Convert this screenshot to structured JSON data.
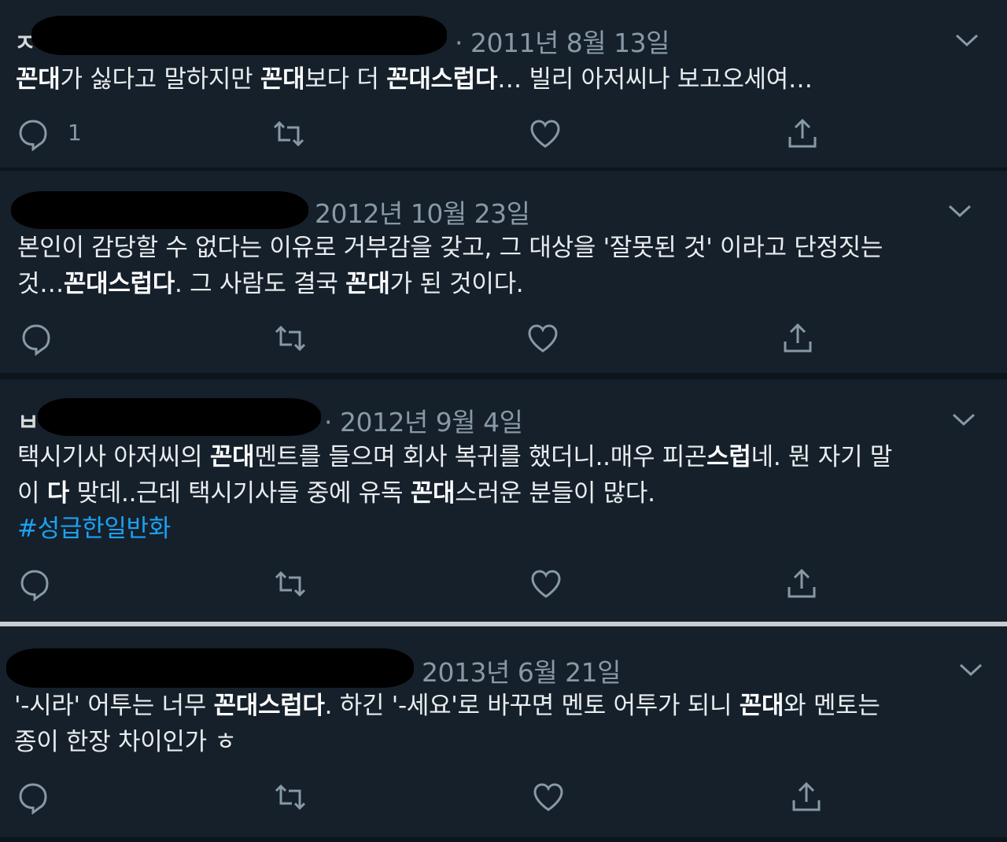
{
  "tweets": [
    {
      "date": "· 2011년 8월 13일",
      "lines": [
        [
          {
            "t": "꼰대",
            "b": true
          },
          {
            "t": "가 싫다고 말하지만 "
          },
          {
            "t": "꼰대",
            "b": true
          },
          {
            "t": "보다 더 "
          },
          {
            "t": "꼰대스럽다",
            "b": true
          },
          {
            "t": "… 빌리 아저씨나 보고오세여…"
          }
        ]
      ],
      "reply_count": "1"
    },
    {
      "date": "2012년 10월 23일",
      "lines": [
        [
          {
            "t": "본인이 감당할 수 없다는 이유로 거부감을 갖고, 그 대상을 '잘못된 것' 이라고 단정짓는"
          }
        ],
        [
          {
            "t": "것…"
          },
          {
            "t": "꼰대스럽다",
            "b": true
          },
          {
            "t": ". 그 사람도 결국 "
          },
          {
            "t": "꼰대",
            "b": true
          },
          {
            "t": "가 된 것이다."
          }
        ]
      ],
      "reply_count": ""
    },
    {
      "date": "· 2012년 9월 4일",
      "lines": [
        [
          {
            "t": "택시기사 아저씨의 "
          },
          {
            "t": "꼰대",
            "b": true
          },
          {
            "t": "멘트를 들으며 회사 복귀를 했더니..매우 피곤"
          },
          {
            "t": "스럽",
            "b": true
          },
          {
            "t": "네. 뭔 자기 말"
          }
        ],
        [
          {
            "t": "이 "
          },
          {
            "t": "다",
            "b": true
          },
          {
            "t": " 맞데..근데 택시기사들 중에 유독 "
          },
          {
            "t": "꼰대",
            "b": true
          },
          {
            "t": "스러운 분들이 많다."
          }
        ]
      ],
      "hashtag": "#성급한일반화",
      "reply_count": ""
    },
    {
      "date": "2013년 6월 21일",
      "lines": [
        [
          {
            "t": "'-시라' 어투는 너무 "
          },
          {
            "t": "꼰대스럽다",
            "b": true
          },
          {
            "t": ". 하긴 '-세요'로 바꾸면 멘토 어투가 되니 "
          },
          {
            "t": "꼰대",
            "b": true
          },
          {
            "t": "와 멘토는"
          }
        ],
        [
          {
            "t": "종이 한장 차이인가 ㅎ"
          }
        ]
      ],
      "reply_count": ""
    }
  ],
  "fragments": {
    "t1": "ㅈ",
    "t3": "ㅂ"
  },
  "icons": {
    "reply": "reply-icon",
    "retweet": "retweet-icon",
    "like": "like-icon",
    "share": "share-icon",
    "more": "chevron-down-icon"
  },
  "colors": {
    "background": "#15202b",
    "text": "#e9ecee",
    "muted": "#8899a6",
    "hashtag": "#1da1f2"
  }
}
